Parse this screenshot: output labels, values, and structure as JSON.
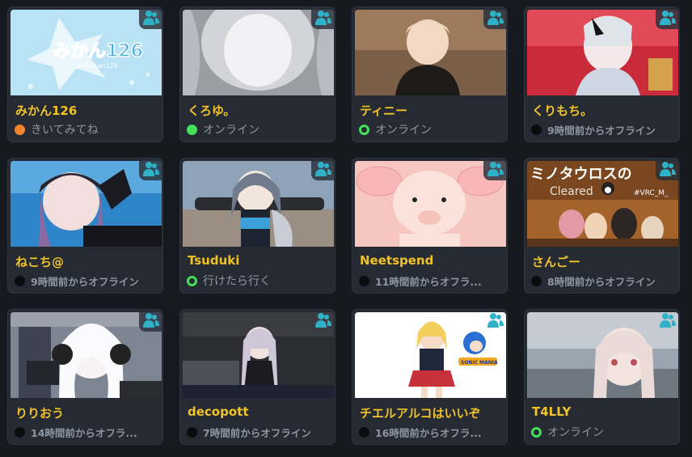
{
  "colors": {
    "join_me": "#f0852b",
    "online": "#44e05a",
    "ask_me": "#44e05a",
    "offline": "#0b0c0e",
    "name": "#f0c22a",
    "friend_icon": "#2fb2c8"
  },
  "friends": [
    {
      "name": "みかん126",
      "status_text": "きいてみてね",
      "status": "join_me",
      "thumb_text": "みかん126",
      "thumb_subtext": "@mi1kan126"
    },
    {
      "name": "くろゆ。",
      "status_text": "オンライン",
      "status": "online"
    },
    {
      "name": "ティニー",
      "status_text": "オンライン",
      "status": "ask_me"
    },
    {
      "name": "くりもち。",
      "status_text": "9時間前からオフライン",
      "status": "offline"
    },
    {
      "name": "ねこち@",
      "status_text": "9時間前からオフライン",
      "status": "offline"
    },
    {
      "name": "Tsuduki",
      "status_text": "行けたら行く",
      "status": "ask_me"
    },
    {
      "name": "Neetspend",
      "status_text": "11時間前からオフラ...",
      "status": "offline"
    },
    {
      "name": "さんごー",
      "status_text": "8時間前からオフライン",
      "status": "offline",
      "thumb_text": "ミノタウロスの",
      "thumb_subtext": "Cleared",
      "thumb_tag": "#VRC_M_"
    },
    {
      "name": "りりおう",
      "status_text": "14時間前からオフラ...",
      "status": "offline"
    },
    {
      "name": "decopott",
      "status_text": "7時間前からオフライン",
      "status": "offline"
    },
    {
      "name": "チエルアルコはいいぞ",
      "status_text": "16時間前からオフラ...",
      "status": "offline",
      "thumb_tag": "SONIC MANIA"
    },
    {
      "name": "T4LLY",
      "status_text": "オンライン",
      "status": "ask_me"
    }
  ]
}
